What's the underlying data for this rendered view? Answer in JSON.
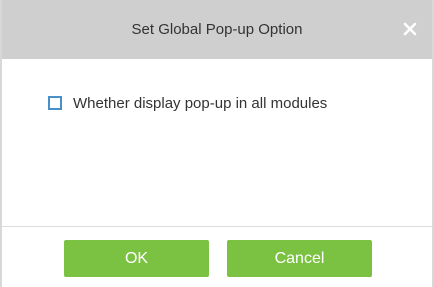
{
  "dialog": {
    "title": "Set Global Pop-up Option",
    "close_icon": "close-icon",
    "option_label": "Whether display pop-up in all modules",
    "option_checked": false,
    "ok_label": "OK",
    "cancel_label": "Cancel"
  },
  "colors": {
    "titlebar": "#cfcfcf",
    "button": "#7cc242",
    "checkbox_border": "#4a90c8"
  }
}
